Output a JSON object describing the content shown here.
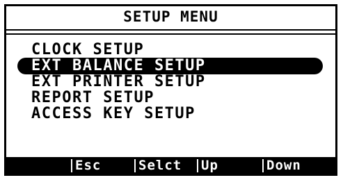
{
  "title": "SETUP MENU",
  "menu": {
    "items": [
      {
        "label": "CLOCK SETUP",
        "selected": false
      },
      {
        "label": "EXT BALANCE SETUP",
        "selected": true
      },
      {
        "label": "EXT PRINTER SETUP",
        "selected": false
      },
      {
        "label": "REPORT SETUP",
        "selected": false
      },
      {
        "label": "ACCESS KEY SETUP",
        "selected": false
      }
    ]
  },
  "softkeys": {
    "esc": "Esc",
    "select": "Selct",
    "up": "Up",
    "down": "Down"
  }
}
